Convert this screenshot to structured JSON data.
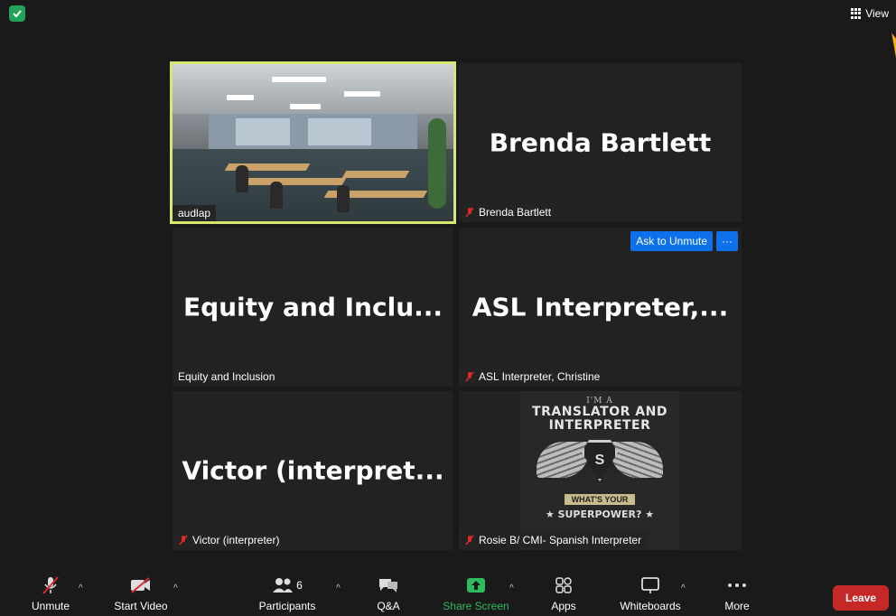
{
  "topbar": {
    "view_label": "View"
  },
  "tiles": {
    "audlap": {
      "label": "audlap"
    },
    "brenda": {
      "big_name": "Brenda Bartlett",
      "label": "Brenda Bartlett"
    },
    "equity": {
      "big_name": "Equity and Inclu...",
      "label": "Equity and Inclusion"
    },
    "asl": {
      "big_name": "ASL Interpreter,...",
      "label": "ASL Interpreter, Christine",
      "ask_to_unmute": "Ask to Unmute",
      "more": "···"
    },
    "victor": {
      "big_name": "Victor (interpret...",
      "label": "Victor (interpreter)"
    },
    "rosie": {
      "label": "Rosie B/ CMI- Spanish Interpreter",
      "poster": {
        "im": "I'M A",
        "line1": "TRANSLATOR AND",
        "line2": "INTERPRETER",
        "badge": "S",
        "banner": "WHAT'S YOUR",
        "super": "★ SUPERPOWER? ★"
      }
    }
  },
  "toolbar": {
    "unmute": "Unmute",
    "start_video": "Start Video",
    "participants": "Participants",
    "participants_count": "6",
    "qa": "Q&A",
    "share_screen": "Share Screen",
    "apps": "Apps",
    "whiteboards": "Whiteboards",
    "more": "More",
    "leave": "Leave",
    "caret": "^"
  },
  "colors": {
    "active_speaker_border": "#d7e66e",
    "share_screen": "#2dbb5d",
    "leave": "#c62828",
    "ask_unmute": "#0e71eb",
    "muted": "#e02828",
    "pointer_arrow": "#f6b30e"
  }
}
